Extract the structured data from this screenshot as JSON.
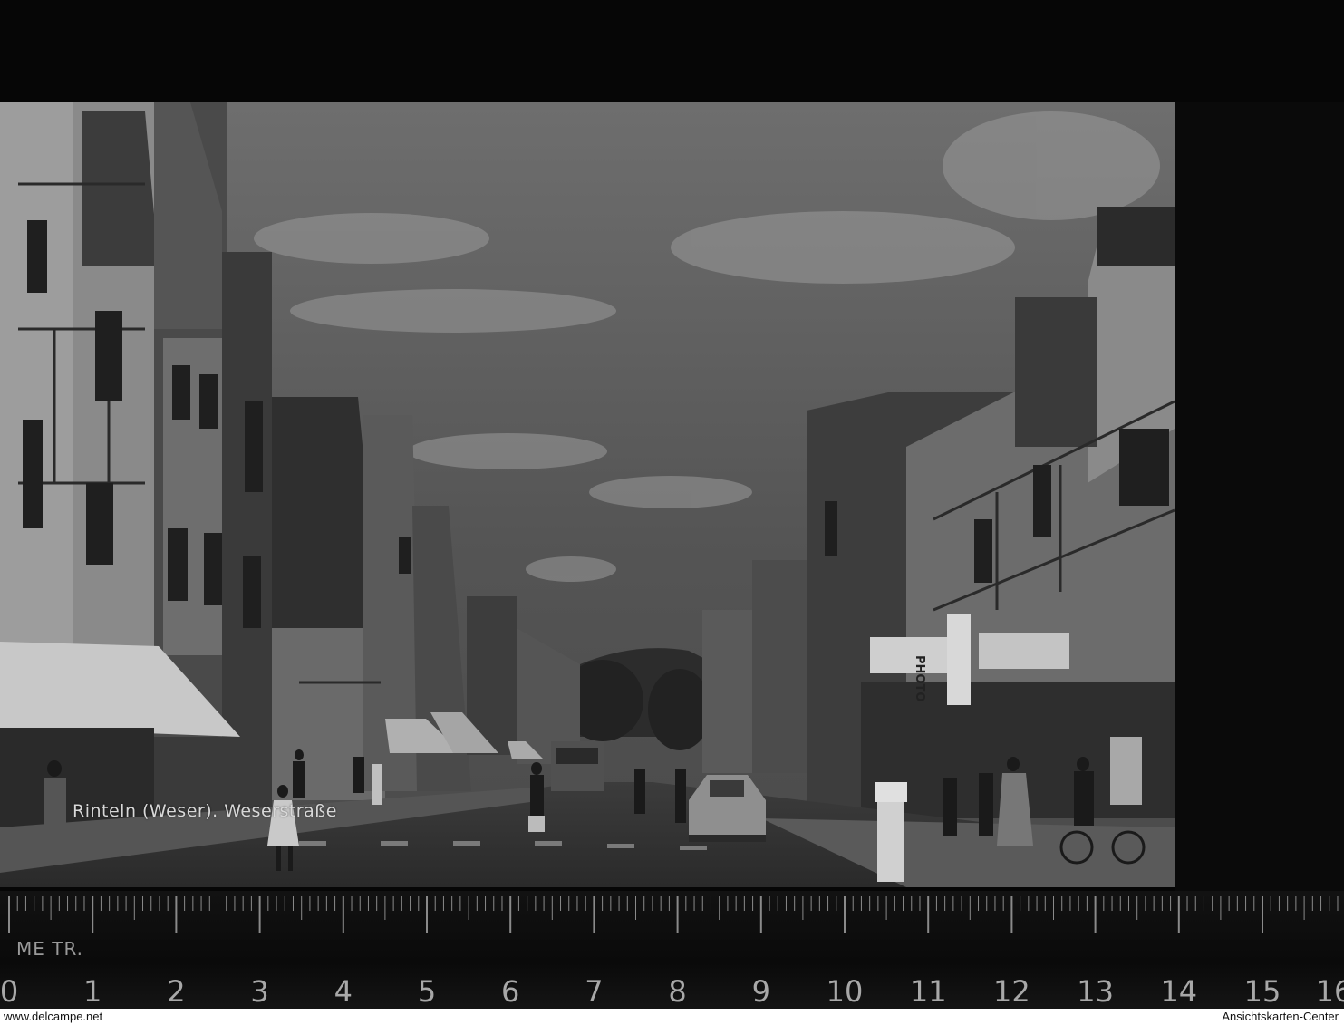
{
  "photo": {
    "caption": "Rinteln (Weser). Weserstraße",
    "shop_signs": [
      "PHOTO"
    ]
  },
  "ruler": {
    "unit_label": "ME TR.",
    "numbers": [
      "0",
      "1",
      "2",
      "3",
      "4",
      "5",
      "6",
      "7",
      "8",
      "9",
      "10",
      "11",
      "12",
      "13",
      "14",
      "15",
      "16"
    ]
  },
  "footer": {
    "left_text": "www.delcampe.net",
    "right_text": "Ansichtskarten-Center"
  }
}
